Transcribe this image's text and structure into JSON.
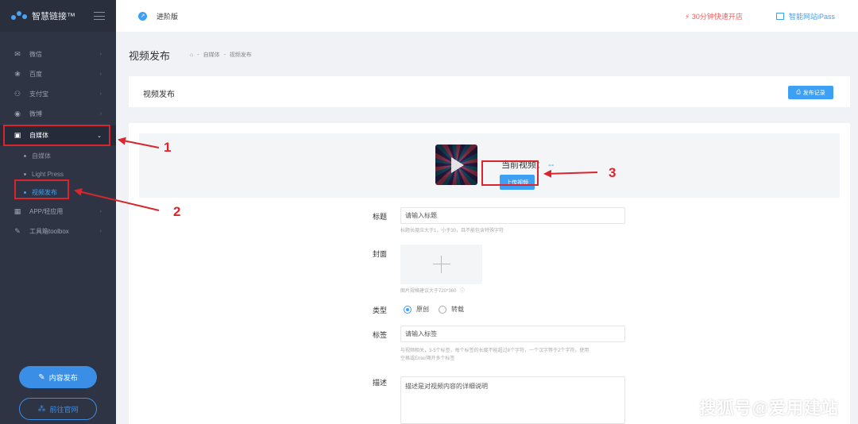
{
  "sidebar": {
    "app_title": "智慧链接™",
    "items": [
      {
        "label": "微信",
        "icon": "wechat-icon",
        "glyph": "✉"
      },
      {
        "label": "百度",
        "icon": "baidu-paw-icon",
        "glyph": "❀"
      },
      {
        "label": "支付宝",
        "icon": "alipay-icon",
        "glyph": "⚇"
      },
      {
        "label": "微博",
        "icon": "weibo-icon",
        "glyph": "◉"
      },
      {
        "label": "自媒体",
        "icon": "camera-icon",
        "glyph": "▣"
      }
    ],
    "sub_items": [
      {
        "label": "自媒体"
      },
      {
        "label": "Light Press"
      },
      {
        "label": "视频发布"
      }
    ],
    "bottom_items": [
      {
        "label": "APP/轻应用",
        "icon": "grid-icon",
        "glyph": "▦"
      },
      {
        "label": "工具箱toolbox",
        "icon": "wrench-icon",
        "glyph": "✎"
      }
    ],
    "publish_button": "内容发布",
    "official_site_button": "前往官网"
  },
  "topbar": {
    "level": "进阶版",
    "promo": "30分钟快速开店",
    "ipass": "智能网站iPass"
  },
  "breadcrumb": {
    "page_title": "视频发布",
    "crumb_1": "自媒体",
    "crumb_2": "视频发布",
    "separator": "-"
  },
  "card_header": {
    "title": "视频发布",
    "records_button": "发布记录"
  },
  "upload": {
    "current_video_label": "当前视频：",
    "current_video_value": "--",
    "upload_button": "上传视频"
  },
  "form": {
    "title_label": "标题",
    "title_placeholder": "请输入标题",
    "title_help": "标题长度应大于1，小于30，且不能包含特殊字符",
    "cover_label": "封面",
    "cover_help": "图片规格建议大于720*360",
    "type_label": "类型",
    "type_options": [
      "原创",
      "转载"
    ],
    "type_selected": "原创",
    "tags_label": "标签",
    "tags_placeholder": "请输入标签",
    "tags_help_1": "与视频相关，3-5个标签，每个标签的长度不能超过8个字符，一个汉字等于2个字符，使用",
    "tags_help_2": "空格或Enter隔开多个标签",
    "desc_label": "描述",
    "desc_placeholder": "描述是对视频内容的详细说明"
  },
  "annotations": [
    "1",
    "2",
    "3"
  ],
  "watermark": "搜狐号@爱用建站",
  "colors": {
    "sidebar_bg": "#2f3445",
    "accent": "#3ea0f4",
    "annotation_red": "#d9262c",
    "promo_red": "#f45b5b"
  }
}
